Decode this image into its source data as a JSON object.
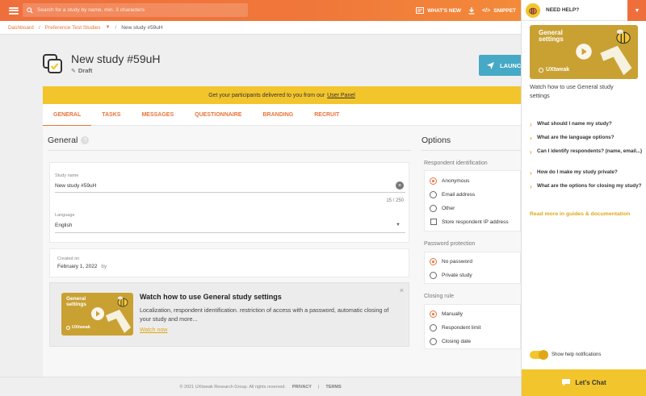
{
  "topbar": {
    "search_placeholder": "Search for a study by name, min. 3 characters",
    "whats_new": "WHAT'S NEW",
    "snippet": "SNIPPET"
  },
  "breadcrumb": {
    "items": [
      "Dashboard",
      "Preference Test Studies"
    ],
    "current": "New study #59uH"
  },
  "study": {
    "title": "New study #59uH",
    "status": "Draft",
    "launch_label": "LAUNCH"
  },
  "banner": {
    "text": "Get your participants delivered to you from our",
    "link": "User Panel"
  },
  "tabs": [
    "GENERAL",
    "TASKS",
    "MESSAGES",
    "QUESTIONNAIRE",
    "BRANDING",
    "RECRUIT"
  ],
  "general": {
    "heading": "General",
    "help_glyph": "?",
    "study_name_label": "Study name",
    "study_name_value": "New study #59uH",
    "char_count": "15 / 250",
    "language_label": "Language",
    "language_value": "English",
    "created_label": "Created on",
    "created_value": "February 1, 2022",
    "created_by": "by"
  },
  "video_card": {
    "thumb_title": "General settings",
    "thumb_brand": "UXtweak",
    "title": "Watch how to use General study settings",
    "description": "Localization, respondent identification. restriction of access with a password, automatic closing of your study and more...",
    "link": "Watch now",
    "close": "×"
  },
  "options": {
    "heading": "Options",
    "respondent": {
      "title": "Respondent identification",
      "items": [
        "Anonymous",
        "Email address",
        "Other"
      ],
      "checkbox": "Store respondent IP address"
    },
    "password": {
      "title": "Password protection",
      "items": [
        "No password",
        "Private study"
      ]
    },
    "closing": {
      "title": "Closing rule",
      "items": [
        "Manually",
        "Respondent limit",
        "Closing date"
      ]
    }
  },
  "footer": {
    "copyright": "© 2021 UXtweak Research Group. All rights reserved.",
    "privacy": "PRIVACY",
    "sep": "|",
    "terms": "TERMS"
  },
  "help_panel": {
    "header": "NEED HELP?",
    "thumb_title": "General settings",
    "thumb_brand": "UXtweak",
    "caption": "Watch how to use General study settings",
    "faqs": [
      "What should I name my study?",
      "What are the language options?",
      "Can I identify respondents? (name, email...)",
      "How do I make my study private?",
      "What are the options for closing my study?"
    ],
    "read_more": "Read more in guides & documentation",
    "toggle_label": "Show help notifications",
    "chat_label": "Let's Chat"
  },
  "colors": {
    "accent": "#ef6f3c",
    "yellow": "#f3c52d",
    "launch": "#46a9c6"
  }
}
